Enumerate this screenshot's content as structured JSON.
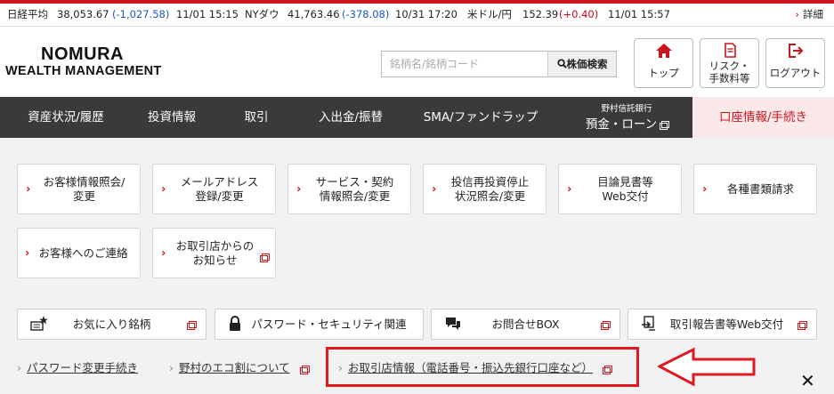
{
  "ticker": {
    "nikkei": {
      "label": "日経平均",
      "value": "38,053.67",
      "change": "(-1,027.58)",
      "time": "11/01 15:15"
    },
    "dow": {
      "label": "NYダウ",
      "value": "41,763.46",
      "change": "(-378.08)",
      "time": "10/31 17:20"
    },
    "usdjpy": {
      "label": "米ドル/円",
      "value": "152.39",
      "change": "(+0.40)",
      "time": "11/01 15:57"
    },
    "detail": "詳細"
  },
  "logo": {
    "line1": "NOMURA",
    "line2": "WEALTH MANAGEMENT"
  },
  "search": {
    "placeholder": "銘柄名/銘柄コード",
    "button": "株価検索"
  },
  "header_buttons": [
    {
      "label": "トップ",
      "icon": "home-icon"
    },
    {
      "label_line1": "リスク・",
      "label_line2": "手数料等",
      "icon": "document-icon"
    },
    {
      "label": "ログアウト",
      "icon": "logout-icon"
    }
  ],
  "nav": [
    {
      "label": "資産状況/履歴"
    },
    {
      "label": "投資情報"
    },
    {
      "label": "取引"
    },
    {
      "label": "入出金/振替"
    },
    {
      "label": "SMA/ファンドラップ"
    },
    {
      "small": "野村信託銀行",
      "label": "預金・ローン"
    },
    {
      "label": "口座情報/手続き",
      "active": true
    }
  ],
  "cards": [
    {
      "line1": "お客様情報照会/",
      "line2": "変更"
    },
    {
      "line1": "メールアドレス",
      "line2": "登録/変更"
    },
    {
      "line1": "サービス・契約",
      "line2": "情報照会/変更"
    },
    {
      "line1": "投信再投資停止",
      "line2": "状況照会/変更"
    },
    {
      "line1": "目論見書等",
      "line2": "Web交付"
    },
    {
      "line1": "各種書類請求"
    },
    {
      "line1": "お客様へのご連絡"
    },
    {
      "line1": "お取引店からの",
      "line2": "お知らせ"
    }
  ],
  "quick_buttons": [
    {
      "label": "お気に入り銘柄",
      "icon": "star-list-icon"
    },
    {
      "label": "パスワード・セキュリティ関連",
      "icon": "lock-icon"
    },
    {
      "label": "お問合せBOX",
      "icon": "chat-icon"
    },
    {
      "label": "取引報告書等Web交付",
      "icon": "transfer-icon"
    }
  ],
  "links": [
    {
      "label": "パスワード変更手続き"
    },
    {
      "label": "野村のエコ割について"
    },
    {
      "label": "お取引店情報（電話番号・振込先銀行口座など）"
    }
  ],
  "colors": {
    "brand_red": "#c8161d",
    "nav_bg": "#3a3a3a",
    "negative": "#1a56c8",
    "positive": "#d0021b"
  }
}
